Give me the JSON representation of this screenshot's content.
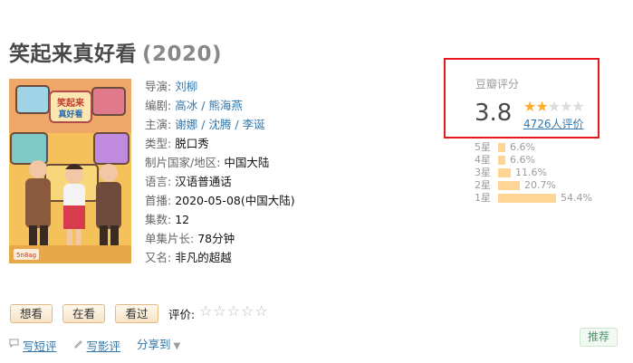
{
  "title": {
    "name": "笑起来真好看",
    "year": "(2020)"
  },
  "poster": {
    "badge": "5n8ag"
  },
  "info": {
    "director": {
      "label": "导演:",
      "values": [
        "刘柳"
      ]
    },
    "writer": {
      "label": "编剧:",
      "values": [
        "高冰",
        "熊海燕"
      ]
    },
    "cast": {
      "label": "主演:",
      "values": [
        "谢娜",
        "沈腾",
        "李诞"
      ]
    },
    "genre": {
      "label": "类型:",
      "value": "脱口秀"
    },
    "country": {
      "label": "制片国家/地区:",
      "value": "中国大陆"
    },
    "language": {
      "label": "语言:",
      "value": "汉语普通话"
    },
    "premiere": {
      "label": "首播:",
      "value": "2020-05-08(中国大陆)"
    },
    "episodes": {
      "label": "集数:",
      "value": "12"
    },
    "runtime": {
      "label": "单集片长:",
      "value": "78分钟"
    },
    "aka": {
      "label": "又名:",
      "value": "非凡的超越"
    },
    "separator": " / "
  },
  "rating": {
    "title": "豆瓣评分",
    "score": "3.8",
    "stars_filled": 2,
    "stars_total": 5,
    "votes": "4726人评价",
    "distribution": [
      {
        "label": "5星",
        "percent": "6.6%",
        "value": 6.6
      },
      {
        "label": "4星",
        "percent": "6.6%",
        "value": 6.6
      },
      {
        "label": "3星",
        "percent": "11.6%",
        "value": 11.6
      },
      {
        "label": "2星",
        "percent": "20.7%",
        "value": 20.7
      },
      {
        "label": "1星",
        "percent": "54.4%",
        "value": 54.4
      }
    ],
    "highlight_color": "#e8191d",
    "star_color": "#ffac2d",
    "bar_color": "#ffd596"
  },
  "buttons": {
    "wish": "想看",
    "doing": "在看",
    "collect": "看过"
  },
  "user_rating": {
    "label": "评价:",
    "stars": "☆☆☆☆☆"
  },
  "actions": {
    "review_short": "写短评",
    "review_long": "写影评",
    "share": "分享到",
    "share_caret": "▼"
  },
  "recommend": "推荐",
  "colors": {
    "link": "#3377aa",
    "title": "#494949",
    "muted": "#9b9b9b"
  }
}
